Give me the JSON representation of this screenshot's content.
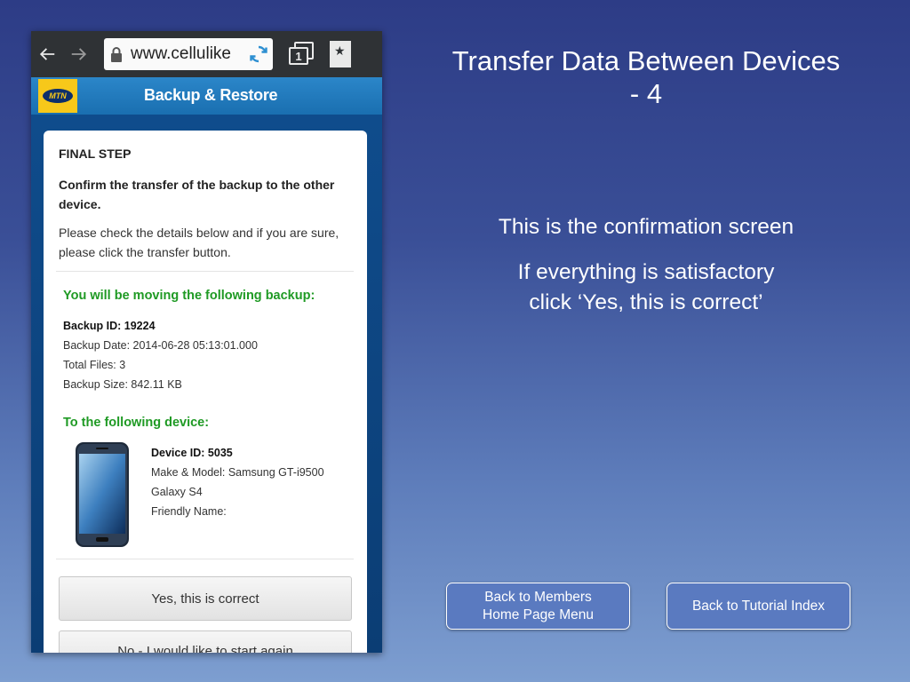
{
  "browser": {
    "url": "www.cellulike",
    "tab_count": "1",
    "bookmark_glyph": "★"
  },
  "app": {
    "logo_text": "MTN",
    "title": "Backup & Restore"
  },
  "form": {
    "heading": "FINAL STEP",
    "confirm_text": "Confirm the transfer of the backup to the other device.",
    "instructions": "Please check the details below and if you are sure, please click the transfer button.",
    "backup_heading": "You will be moving the following backup:",
    "backup": {
      "id": "Backup ID: 19224",
      "date": "Backup Date: 2014-06-28 05:13:01.000",
      "files": "Total Files: 3",
      "size": "Backup Size: 842.11 KB"
    },
    "device_heading": "To the following device:",
    "device": {
      "id": "Device ID: 5035",
      "make_model": "Make & Model: Samsung GT-i9500",
      "model_name": "Galaxy S4",
      "friendly_name": "Friendly Name:"
    },
    "yes_button": "Yes, this is correct",
    "no_button": "No - I would like to start again"
  },
  "slide": {
    "title_line1": "Transfer Data Between Devices",
    "title_line2": "- 4",
    "text1": "This is the confirmation screen",
    "text2_line1": "If everything is satisfactory",
    "text2_line2": "click ‘Yes, this is correct’",
    "nav_members_line1": "Back to Members",
    "nav_members_line2": "Home Page Menu",
    "nav_index": "Back to Tutorial Index"
  },
  "colors": {
    "accent_green": "#1f9a24",
    "mtn_yellow": "#f7c81a",
    "header_blue": "#1a6fb0"
  }
}
